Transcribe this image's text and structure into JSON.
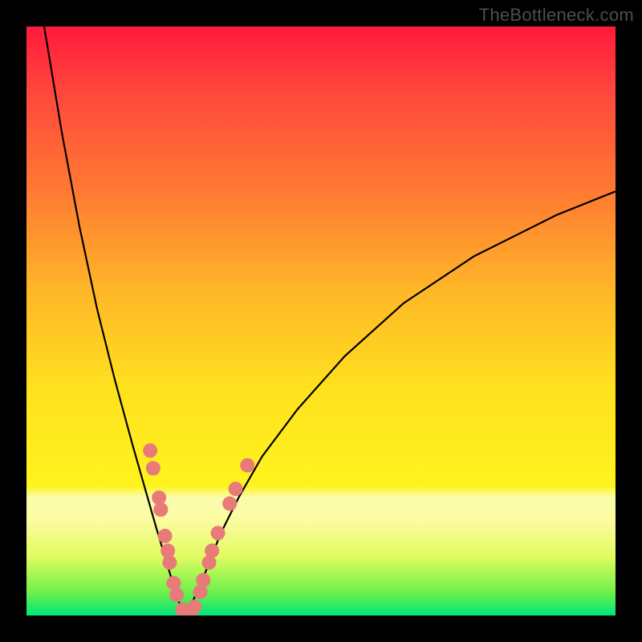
{
  "watermark": "TheBottleneck.com",
  "colors": {
    "marker": "#e87a7a",
    "curve": "#000000"
  },
  "chart_data": {
    "type": "line",
    "title": "",
    "xlabel": "",
    "ylabel": "",
    "xlim": [
      0,
      100
    ],
    "ylim": [
      0,
      100
    ],
    "note": "Unlabeled bottleneck V-curve on a rainbow gradient background. x is normalized parameter (0-100). y is bottleneck magnitude (0 near bottom = no bottleneck, 100 at top = severe). Minimum near x≈27.",
    "series": [
      {
        "name": "left-branch",
        "x": [
          3,
          6,
          9,
          12,
          15,
          18,
          20,
          22,
          23.5,
          25,
          26,
          27
        ],
        "y": [
          100,
          82,
          66,
          52,
          40,
          29,
          22,
          15,
          10,
          5,
          2,
          0
        ]
      },
      {
        "name": "right-branch",
        "x": [
          27,
          28,
          29.5,
          31,
          33,
          36,
          40,
          46,
          54,
          64,
          76,
          90,
          100
        ],
        "y": [
          0,
          2,
          5,
          9,
          14,
          20,
          27,
          35,
          44,
          53,
          61,
          68,
          72
        ]
      }
    ],
    "markers": {
      "name": "highlighted-points",
      "comment": "Pink sample dots clustered along the V near the trough region.",
      "points": [
        {
          "x": 21.0,
          "y": 28.0
        },
        {
          "x": 21.5,
          "y": 25.0
        },
        {
          "x": 22.5,
          "y": 20.0
        },
        {
          "x": 22.8,
          "y": 18.0
        },
        {
          "x": 23.5,
          "y": 13.5
        },
        {
          "x": 24.0,
          "y": 11.0
        },
        {
          "x": 24.3,
          "y": 9.0
        },
        {
          "x": 25.0,
          "y": 5.5
        },
        {
          "x": 25.5,
          "y": 3.5
        },
        {
          "x": 26.5,
          "y": 1.0
        },
        {
          "x": 27.0,
          "y": 0.0
        },
        {
          "x": 27.8,
          "y": 0.3
        },
        {
          "x": 28.5,
          "y": 1.5
        },
        {
          "x": 29.5,
          "y": 4.0
        },
        {
          "x": 30.0,
          "y": 6.0
        },
        {
          "x": 31.0,
          "y": 9.0
        },
        {
          "x": 31.5,
          "y": 11.0
        },
        {
          "x": 32.5,
          "y": 14.0
        },
        {
          "x": 34.5,
          "y": 19.0
        },
        {
          "x": 35.5,
          "y": 21.5
        },
        {
          "x": 37.5,
          "y": 25.5
        }
      ]
    }
  }
}
